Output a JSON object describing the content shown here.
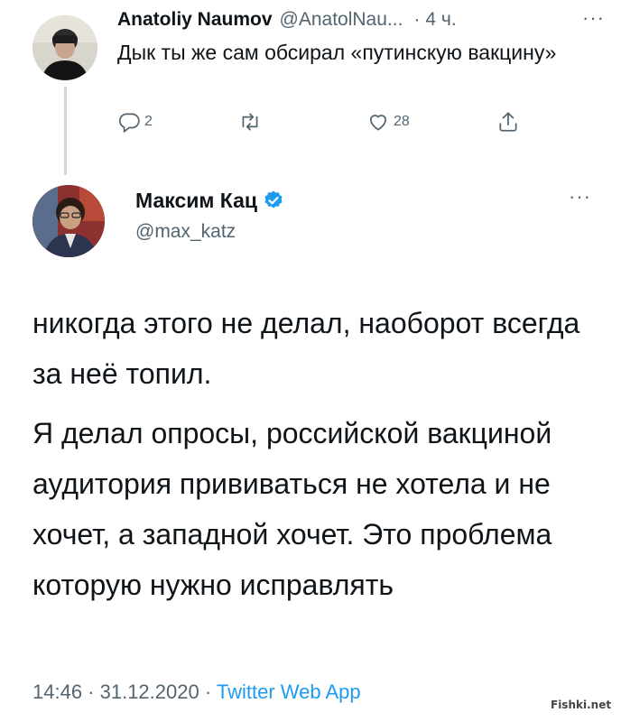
{
  "reply": {
    "name": "Anatoliy Naumov",
    "handle": "@AnatolNau...",
    "separator": "·",
    "time": "4 ч.",
    "more": "···",
    "text": "Дык ты же сам обсирал «путинскую вакцину»",
    "actions": {
      "reply_count": "2",
      "retweet_count": "",
      "like_count": "28"
    }
  },
  "main": {
    "name": "Максим Кац",
    "handle": "@max_katz",
    "more": "···",
    "paragraphs": [
      "никогда этого не делал, наоборот всегда за неё топил.",
      "Я делал опросы, российской вакциной аудитория прививаться не хотела и не хочет, а западной хочет. Это проблема которую нужно исправлять"
    ],
    "timestamp": "14:46 · 31.12.2020 · ",
    "source": "Twitter Web App"
  },
  "watermark": "Fishki.net",
  "colors": {
    "text": "#0f1419",
    "secondary": "#536471",
    "verified": "#1d9bf0",
    "link": "#1d9bf0",
    "thread_line": "#cfd9de"
  }
}
